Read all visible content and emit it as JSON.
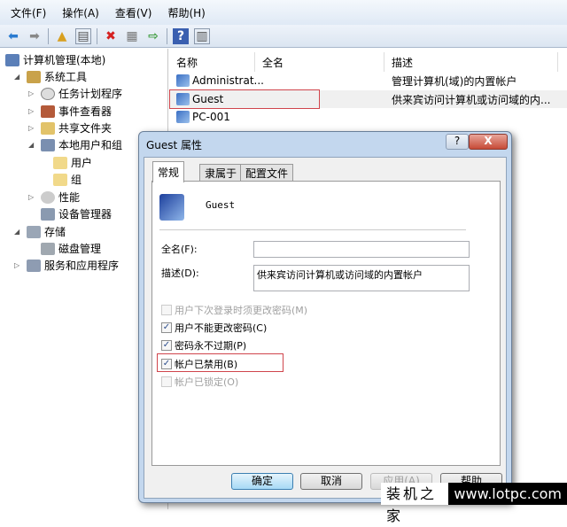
{
  "menu": [
    "文件(F)",
    "操作(A)",
    "查看(V)",
    "帮助(H)"
  ],
  "tree": [
    {
      "label": "计算机管理(本地)"
    },
    {
      "label": "系统工具"
    },
    {
      "label": "任务计划程序"
    },
    {
      "label": "事件查看器"
    },
    {
      "label": "共享文件夹"
    },
    {
      "label": "本地用户和组"
    },
    {
      "label": "用户"
    },
    {
      "label": "组"
    },
    {
      "label": "性能"
    },
    {
      "label": "设备管理器"
    },
    {
      "label": "存储"
    },
    {
      "label": "磁盘管理"
    },
    {
      "label": "服务和应用程序"
    }
  ],
  "list": {
    "columns": [
      "名称",
      "全名",
      "描述"
    ],
    "rows": [
      {
        "name": "Administrat...",
        "desc": "管理计算机(域)的内置帐户"
      },
      {
        "name": "Guest",
        "desc": "供来宾访问计算机或访问域的内..."
      },
      {
        "name": "PC-001",
        "desc": ""
      }
    ]
  },
  "dialog": {
    "title": "Guest 属性",
    "help": "?",
    "close": "X",
    "tabs": [
      "常规",
      "隶属于",
      "配置文件"
    ],
    "username": "Guest",
    "fullname_label": "全名(F):",
    "fullname_value": "",
    "desc_label": "描述(D):",
    "desc_value": "供来宾访问计算机或访问域的内置帐户",
    "checkboxes": [
      {
        "label": "用户下次登录时须更改密码(M)",
        "checked": false,
        "disabled": true
      },
      {
        "label": "用户不能更改密码(C)",
        "checked": true
      },
      {
        "label": "密码永不过期(P)",
        "checked": true
      },
      {
        "label": "帐户已禁用(B)",
        "checked": true
      },
      {
        "label": "帐户已锁定(O)",
        "checked": false,
        "disabled": true
      }
    ],
    "buttons": [
      "确定",
      "取消",
      "应用(A)",
      "帮助"
    ]
  },
  "watermark": {
    "cn": "装机之家",
    "url": "www.lotpc.com"
  }
}
